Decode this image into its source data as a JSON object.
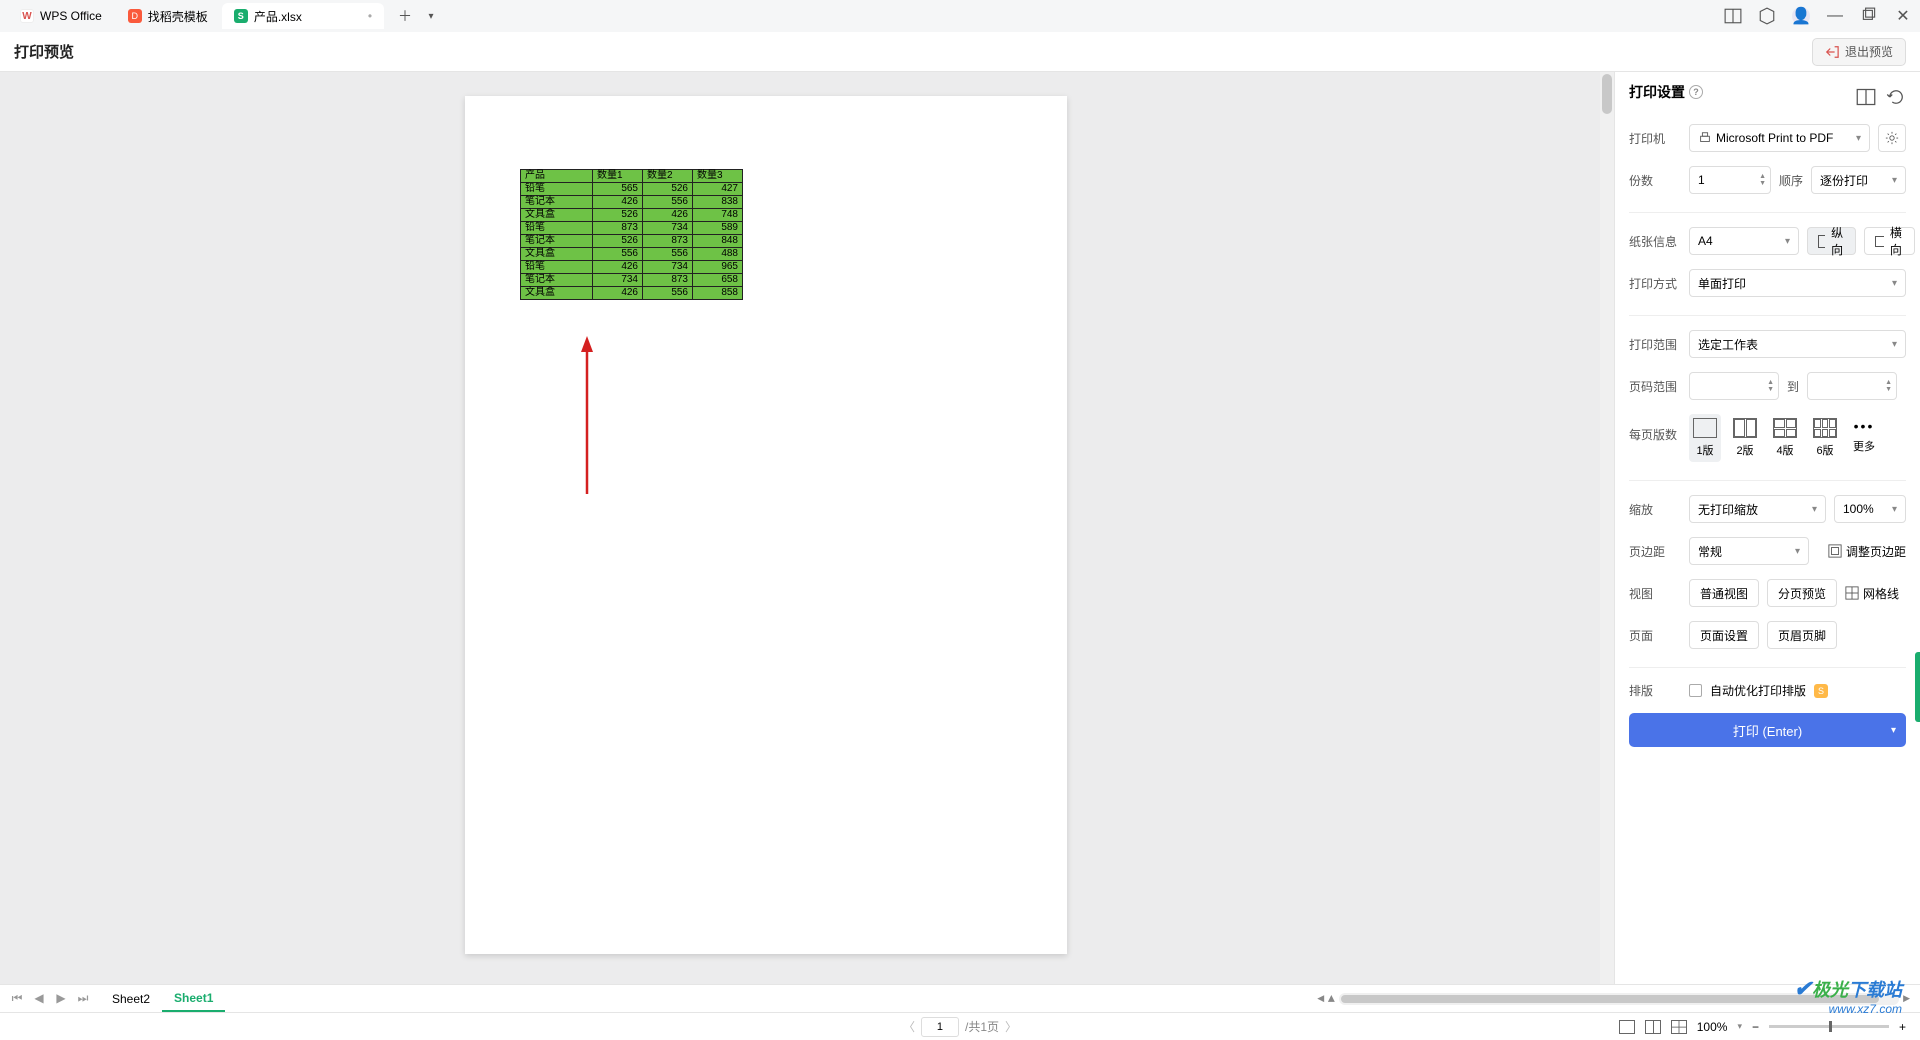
{
  "tabs": {
    "t0": "WPS Office",
    "t1": "找稻壳模板",
    "t2": "产品.xlsx"
  },
  "topbar": {
    "title": "打印预览"
  },
  "exit_label": "退出预览",
  "side": {
    "title": "打印设置",
    "printer_lbl": "打印机",
    "printer_val": "Microsoft Print to PDF",
    "copies_lbl": "份数",
    "copies_val": "1",
    "order_lbl": "顺序",
    "order_val": "逐份打印",
    "paper_lbl": "纸张信息",
    "paper_val": "A4",
    "portrait": "纵向",
    "landscape": "横向",
    "mode_lbl": "打印方式",
    "mode_val": "单面打印",
    "range_lbl": "打印范围",
    "range_val": "选定工作表",
    "pagerange_lbl": "页码范围",
    "to_lbl": "到",
    "perpage_lbl": "每页版数",
    "pp1": "1版",
    "pp2": "2版",
    "pp4": "4版",
    "pp6": "6版",
    "pp_more": "更多",
    "scale_lbl": "缩放",
    "scale_val": "无打印缩放",
    "scale_pct": "100%",
    "margin_lbl": "页边距",
    "margin_val": "常规",
    "margin_adjust": "调整页边距",
    "view_lbl": "视图",
    "view_normal": "普通视图",
    "view_page": "分页预览",
    "view_grid": "网格线",
    "page_lbl": "页面",
    "page_setup": "页面设置",
    "page_hf": "页眉页脚",
    "layout_lbl": "排版",
    "layout_auto": "自动优化打印排版",
    "print_btn": "打印 (Enter)"
  },
  "sheets": {
    "s1": "Sheet2",
    "s2": "Sheet1"
  },
  "status": {
    "page_input": "1",
    "page_total": "/共1页",
    "zoom": "100%"
  },
  "watermark": {
    "brand1": "极光",
    "brand2": "下载站",
    "url": "www.xz7.com"
  },
  "chart_data": {
    "type": "table",
    "headers": [
      "产品",
      "数量1",
      "数量2",
      "数量3"
    ],
    "rows": [
      [
        "铅笔",
        565,
        526,
        427
      ],
      [
        "笔记本",
        426,
        556,
        838
      ],
      [
        "文具盒",
        526,
        426,
        748
      ],
      [
        "铅笔",
        873,
        734,
        589
      ],
      [
        "笔记本",
        526,
        873,
        848
      ],
      [
        "文具盒",
        556,
        556,
        488
      ],
      [
        "铅笔",
        426,
        734,
        965
      ],
      [
        "笔记本",
        734,
        873,
        658
      ],
      [
        "文具盒",
        426,
        556,
        858
      ]
    ]
  }
}
